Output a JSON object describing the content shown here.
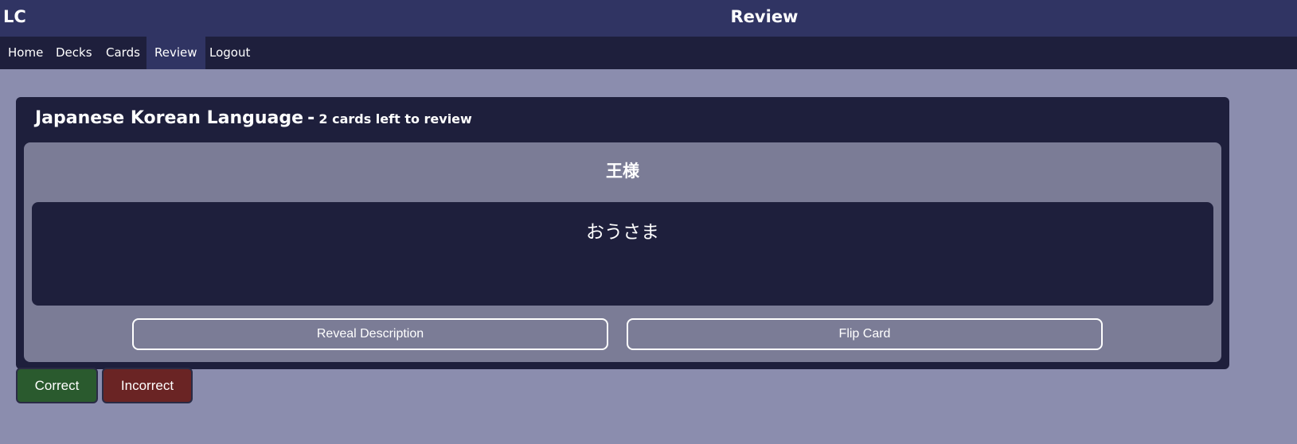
{
  "app": {
    "brand": "LC",
    "page_title": "Review"
  },
  "nav": {
    "items": [
      {
        "label": "Home",
        "active": false
      },
      {
        "label": "Decks",
        "active": false
      },
      {
        "label": "Cards",
        "active": false
      },
      {
        "label": "Review",
        "active": true
      },
      {
        "label": "Logout",
        "active": false
      }
    ]
  },
  "review": {
    "deck_name": "Japanese Korean Language",
    "separator": "-",
    "remaining_text": "2 cards left to review",
    "card": {
      "front": "王様",
      "back": "おうさま"
    },
    "buttons": {
      "reveal_description": "Reveal Description",
      "flip_card": "Flip Card",
      "correct": "Correct",
      "incorrect": "Incorrect"
    }
  },
  "colors": {
    "background": "#8b8dae",
    "topbar": "#303463",
    "navbar": "#1e1f3c",
    "panel": "#1e1f3c",
    "card_area": "#7b7c96",
    "correct": "#2a5a2e",
    "incorrect": "#6a2424"
  }
}
